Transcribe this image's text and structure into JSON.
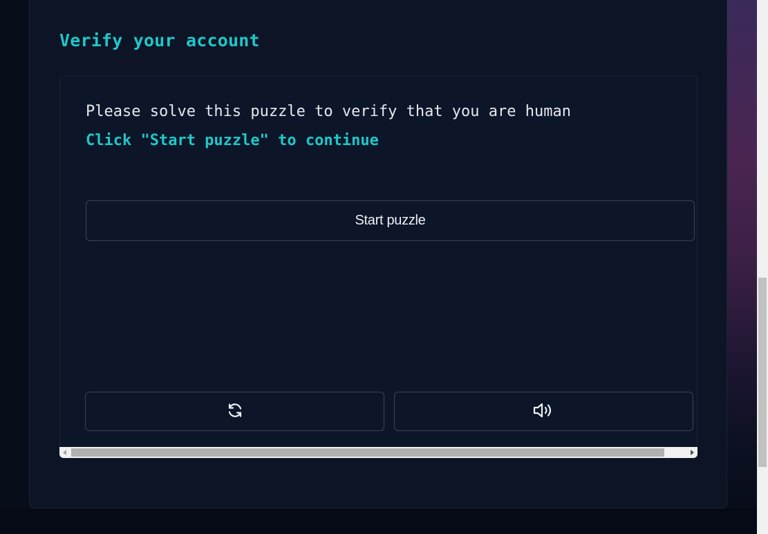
{
  "heading": "Verify your account",
  "puzzle": {
    "instruction": "Please solve this puzzle to verify that you are human",
    "hint": "Click \"Start puzzle\" to continue",
    "start_button_label": "Start puzzle",
    "reload_icon": "reload-icon",
    "audio_icon": "audio-icon"
  },
  "colors": {
    "accent": "#1ec8c8",
    "card_bg": "#0c1426",
    "page_bg": "#0a0f1d",
    "button_border": "#3a4458"
  }
}
